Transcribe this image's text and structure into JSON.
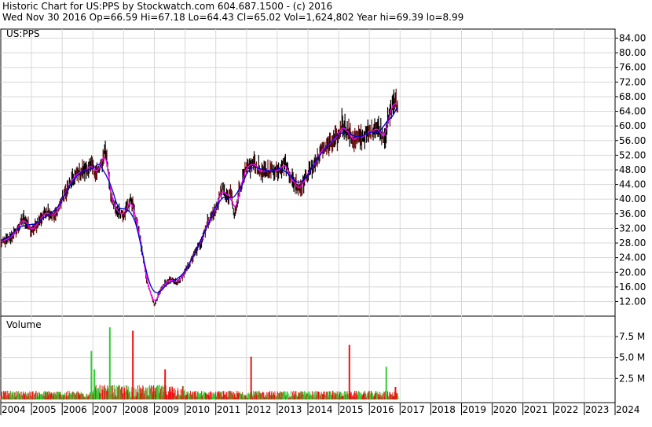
{
  "header": {
    "line1": "Historic Chart for US:PPS by Stockwatch.com 604.687.1500 - (c) 2016",
    "line2": "Wed Nov 30 2016   Op=66.59   Hi=67.18   Lo=64.43   Cl=65.02   Vol=1,624,802   Year hi=69.39   lo=8.99"
  },
  "colors": {
    "price": "#000000",
    "ma_short": "#ff00ff",
    "ma_long": "#0000cc",
    "vol_up": "#33cc33",
    "vol_down": "#ee1111",
    "grid": "#d8d8d8"
  },
  "chart_data": [
    {
      "type": "line",
      "title": "US:PPS",
      "ylim": [
        8,
        88
      ],
      "yticks": [
        "84.00",
        "80.00",
        "76.00",
        "72.00",
        "68.00",
        "64.00",
        "60.00",
        "56.00",
        "52.00",
        "48.00",
        "44.00",
        "40.00",
        "36.00",
        "32.00",
        "28.00",
        "24.00",
        "20.00",
        "16.00",
        "12.00"
      ],
      "xticks": [
        "2004",
        "2005",
        "2006",
        "2007",
        "2008",
        "2009",
        "2010",
        "2011",
        "2012",
        "2013",
        "2014",
        "2015",
        "2016",
        "2017",
        "2018",
        "2019",
        "2020",
        "2021",
        "2022",
        "2023",
        "2024"
      ],
      "xlim": [
        2004,
        2024
      ],
      "grid": true,
      "series": [
        {
          "x": [
            2004.0,
            2004.25,
            2004.5,
            2004.75,
            2005.0,
            2005.25,
            2005.5,
            2005.75,
            2006.0,
            2006.25,
            2006.5,
            2006.75,
            2007.0,
            2007.1,
            2007.2,
            2007.3,
            2007.4,
            2007.5,
            2007.6,
            2007.75,
            2008.0,
            2008.25,
            2008.5,
            2008.75,
            2009.0,
            2009.1,
            2009.25,
            2009.5,
            2009.75,
            2010.0,
            2010.25,
            2010.5,
            2010.75,
            2011.0,
            2011.2,
            2011.4,
            2011.5,
            2011.6,
            2011.75,
            2012.0,
            2012.25,
            2012.5,
            2012.75,
            2013.0,
            2013.25,
            2013.5,
            2013.75,
            2014.0,
            2014.25,
            2014.5,
            2014.75,
            2015.0,
            2015.1,
            2015.25,
            2015.5,
            2015.75,
            2016.0,
            2016.2,
            2016.4,
            2016.5,
            2016.6,
            2016.7,
            2016.8,
            2016.92
          ],
          "values": [
            28,
            29,
            31,
            35,
            31,
            34,
            37,
            35,
            40,
            44,
            47,
            48,
            49,
            47,
            48,
            50,
            54,
            48,
            40,
            37,
            36,
            40,
            31,
            18,
            11,
            13,
            16,
            18,
            17,
            20,
            24,
            28,
            34,
            37,
            43,
            40,
            42,
            35,
            42,
            48,
            50,
            47,
            48,
            48,
            50,
            45,
            43,
            47,
            50,
            54,
            55,
            57,
            61,
            59,
            56,
            57,
            58,
            60,
            58,
            57,
            61,
            64,
            67,
            65
          ]
        }
      ]
    },
    {
      "type": "bar",
      "title": "Volume",
      "yticks": [
        "7.5 M",
        "5.0 M",
        "2.5 M"
      ],
      "ylim": [
        0,
        10
      ],
      "spikes": [
        {
          "x": 2006.95,
          "value": 5.8,
          "dir": "up"
        },
        {
          "x": 2007.05,
          "value": 3.6,
          "dir": "up"
        },
        {
          "x": 2007.55,
          "value": 8.6,
          "dir": "up"
        },
        {
          "x": 2008.3,
          "value": 8.2,
          "dir": "down"
        },
        {
          "x": 2009.35,
          "value": 3.6,
          "dir": "down"
        },
        {
          "x": 2012.15,
          "value": 5.1,
          "dir": "down"
        },
        {
          "x": 2015.35,
          "value": 6.5,
          "dir": "down"
        },
        {
          "x": 2016.55,
          "value": 3.9,
          "dir": "up"
        },
        {
          "x": 2016.85,
          "value": 1.5,
          "dir": "down"
        }
      ]
    }
  ]
}
